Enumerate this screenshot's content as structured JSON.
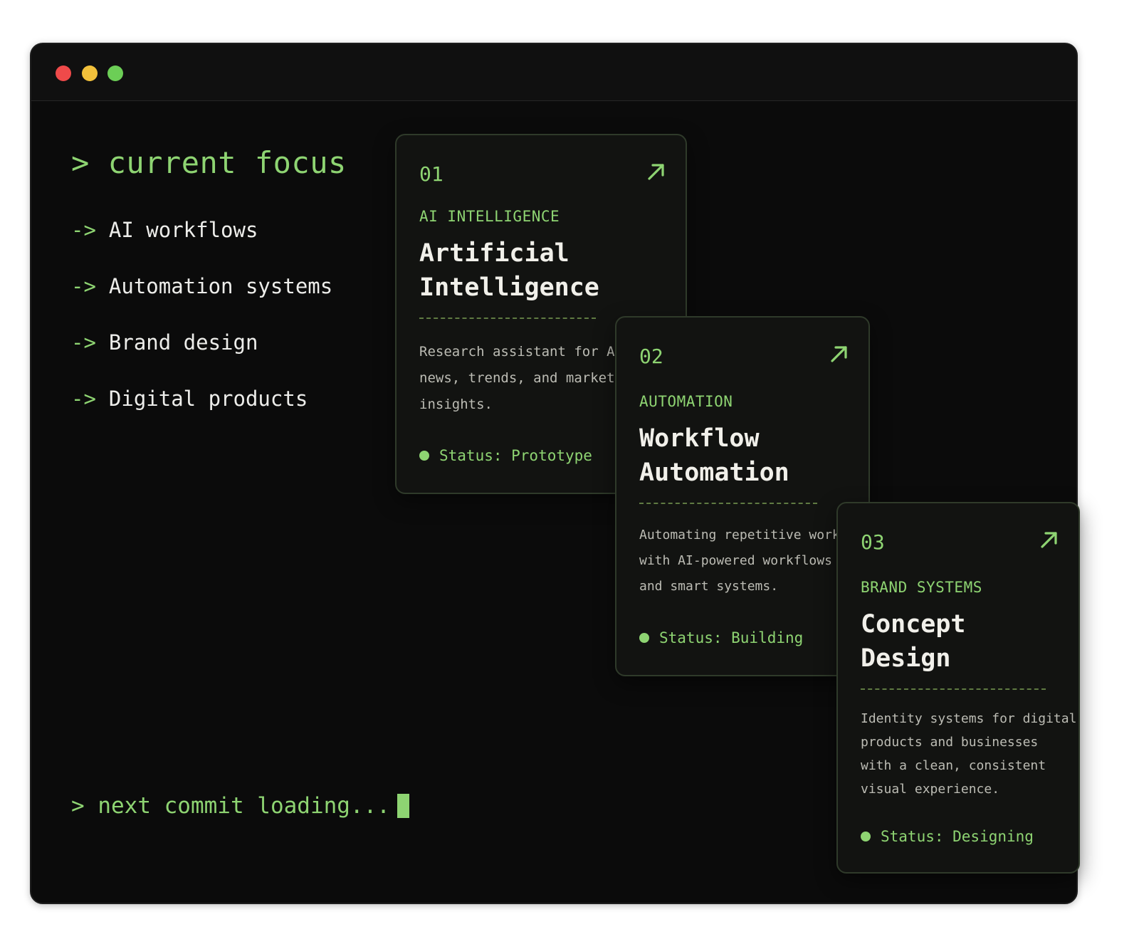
{
  "colors": {
    "accent": "#8ed472",
    "window_bg": "#0b0b0b",
    "card_bg": "#121311",
    "text": "#ededea",
    "close": "#ef4a4a",
    "minimize": "#f2c13b",
    "maximize": "#6cce56"
  },
  "focus": {
    "heading": "> current focus",
    "items": [
      {
        "arrow": "->",
        "label": "AI workflows"
      },
      {
        "arrow": "->",
        "label": "Automation systems"
      },
      {
        "arrow": "->",
        "label": "Brand design"
      },
      {
        "arrow": "->",
        "label": "Digital products"
      }
    ]
  },
  "commit": {
    "text": "> next commit loading..."
  },
  "cards": [
    {
      "number": "01",
      "icon": "arrow-up-right-icon",
      "category": "AI INTELLIGENCE",
      "title_lines": [
        "Artificial",
        "Intelligence"
      ],
      "desc_lines": [
        "Research assistant for AI",
        "news, trends, and market",
        "insights."
      ],
      "status": "Status: Prototype"
    },
    {
      "number": "02",
      "icon": "arrow-up-right-icon",
      "category": "AUTOMATION",
      "title_lines": [
        "Workflow",
        "Automation"
      ],
      "desc_lines": [
        "Automating repetitive work",
        "with AI-powered workflows",
        "and smart systems."
      ],
      "status": "Status: Building"
    },
    {
      "number": "03",
      "icon": "arrow-up-right-icon",
      "category": "BRAND SYSTEMS",
      "title_lines": [
        "Concept",
        "Design"
      ],
      "desc_lines": [
        "Identity systems for digital",
        "products and businesses",
        "with a clean, consistent",
        "visual experience."
      ],
      "status": "Status: Designing"
    }
  ]
}
